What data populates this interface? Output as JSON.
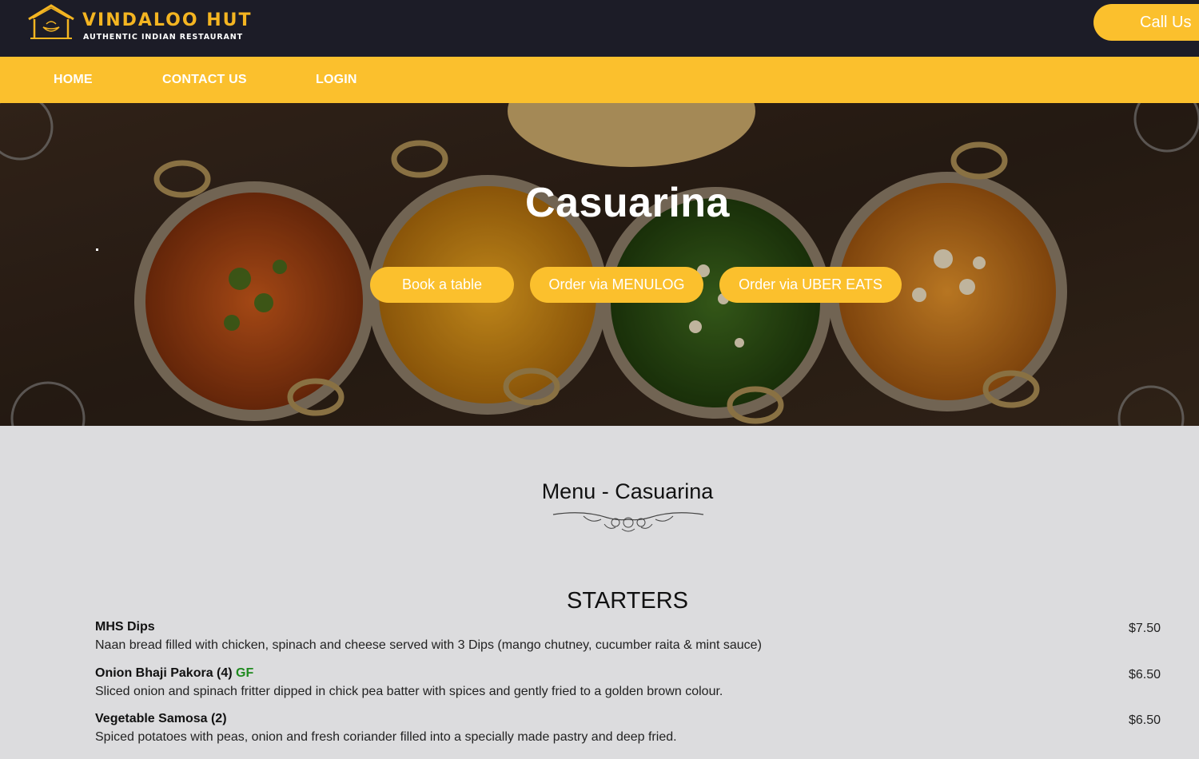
{
  "brand": {
    "name": "VINDALOO HUT",
    "tagline": "AUTHENTIC INDIAN RESTAURANT",
    "accent_color": "#fbc02d",
    "header_bg": "#1c1c27"
  },
  "header": {
    "call_label": "Call Us"
  },
  "nav": {
    "items": [
      {
        "label": "HOME"
      },
      {
        "label": "CONTACT US"
      },
      {
        "label": "LOGIN"
      }
    ]
  },
  "hero": {
    "title": "Casuarina",
    "buttons": [
      {
        "label": "Book a table"
      },
      {
        "label": "Order via MENULOG"
      },
      {
        "label": "Order via UBER EATS"
      }
    ]
  },
  "menu": {
    "title": "Menu - Casuarina",
    "sections": [
      {
        "title": "STARTERS",
        "items": [
          {
            "name": "MHS Dips",
            "badge": "",
            "description": "Naan bread filled with chicken, spinach and cheese served with 3 Dips (mango chutney, cucumber raita & mint sauce)",
            "price": "$7.50"
          },
          {
            "name": "Onion Bhaji Pakora (4)",
            "badge": "GF",
            "description": "Sliced onion and spinach fritter dipped in chick pea batter with spices and gently fried to a golden brown colour.",
            "price": "$6.50"
          },
          {
            "name": "Vegetable Samosa (2)",
            "badge": "",
            "description": "Spiced potatoes with peas, onion and fresh coriander filled into a specially made pastry and deep fried.",
            "price": "$6.50"
          }
        ]
      }
    ]
  }
}
